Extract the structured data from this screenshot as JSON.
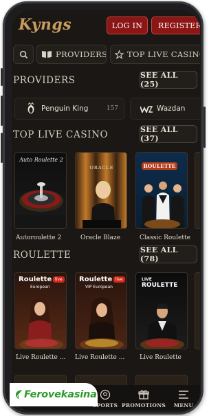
{
  "header": {
    "logo": "Kyngs",
    "login_label": "LOG IN",
    "register_label": "REGISTER"
  },
  "pills": [
    {
      "label": "",
      "icon": "search-icon"
    },
    {
      "label": "PROVIDERS",
      "icon": "book-icon"
    },
    {
      "label": "TOP LIVE CASINO",
      "icon": "star-icon"
    }
  ],
  "providers_section": {
    "title": "PROVIDERS",
    "see_all": "SEE ALL (25)",
    "items": [
      {
        "name": "Penguin King",
        "count": "157",
        "icon": "penguin-king-logo"
      },
      {
        "name": "Wazdan",
        "count": "",
        "icon": "wazdan-logo"
      }
    ]
  },
  "live_section": {
    "title": "TOP LIVE CASINO",
    "see_all": "SEE ALL (37)",
    "games": [
      {
        "name": "Autoroulette 2",
        "art": "Auto Roulette 2"
      },
      {
        "name": "Oracle Blaze",
        "art": "ORACLE"
      },
      {
        "name": "Classic Roulette",
        "art": "ROULETTE"
      }
    ]
  },
  "roulette_section": {
    "title": "ROULETTE",
    "see_all": "SEE ALL (78)",
    "games": [
      {
        "name": "Live Roulette ...",
        "art": "Roulette",
        "art_sub": "European",
        "badge": "live"
      },
      {
        "name": "Live Roulette ...",
        "art": "Roulette",
        "art_sub": "VIP European",
        "badge": "live"
      },
      {
        "name": "Live Roulette",
        "art": "ROULETTE",
        "art_top": "LIVE"
      }
    ]
  },
  "bottom_nav": [
    {
      "label": "SPORTS",
      "icon": "sports-ball-icon"
    },
    {
      "label": "PROMOTIONS",
      "icon": "gift-icon"
    },
    {
      "label": "MENU",
      "icon": "menu-icon"
    }
  ],
  "watermark": "Ferovekasina",
  "colors": {
    "accent_red": "#8c1616",
    "gold": "#c79c5c",
    "background": "#1a1714"
  }
}
